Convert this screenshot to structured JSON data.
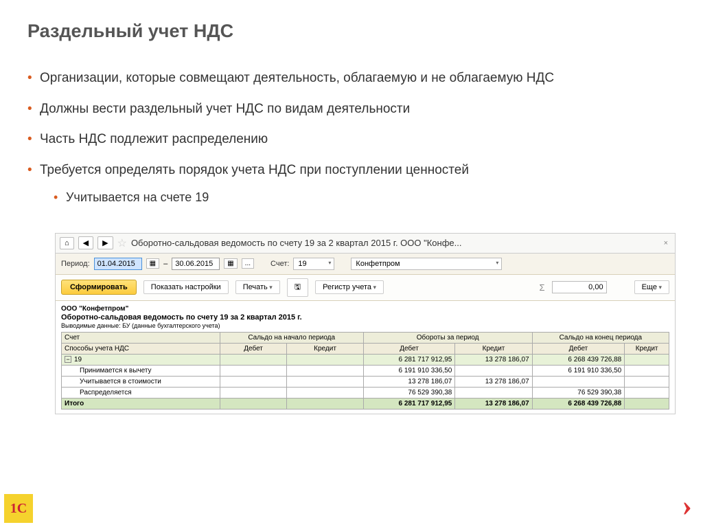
{
  "title": "Раздельный учет НДС",
  "bullets": [
    "Организации, которые совмещают деятельность, облагаемую и не облагаемую НДС",
    "Должны вести раздельный учет НДС по видам деятельности",
    "Часть НДС подлежит распределению",
    "Требуется определять порядок учета НДС при поступлении ценностей"
  ],
  "sub_bullet": "Учитывается на счете 19",
  "app": {
    "doc_title": "Оборотно-сальдовая ведомость по счету 19 за 2 квартал 2015 г. ООО \"Конфе...",
    "home": "⌂",
    "filter": {
      "period_label": "Период:",
      "date_from": "01.04.2015",
      "date_to": "30.06.2015",
      "dots": "...",
      "acct_label": "Счет:",
      "acct_val": "19",
      "org_val": "Конфетпром"
    },
    "toolbar": {
      "form": "Сформировать",
      "show_settings": "Показать настройки",
      "print": "Печать",
      "register": "Регистр учета",
      "numval": "0,00",
      "more": "Еще"
    },
    "report": {
      "org": "ООО \"Конфетпром\"",
      "title": "Оборотно-сальдовая ведомость по счету 19 за 2 квартал 2015 г.",
      "note": "Выводимые данные: БУ (данные бухгалтерского учета)",
      "head": {
        "c1a": "Счет",
        "c1b": "Способы учета НДС",
        "g1": "Сальдо на начало периода",
        "g2": "Обороты за период",
        "g3": "Сальдо на конец периода",
        "d": "Дебет",
        "k": "Кредит"
      },
      "rows": [
        {
          "lvl": "main",
          "name": "19",
          "d1": "",
          "k1": "",
          "d2": "6 281 717 912,95",
          "k2": "13 278 186,07",
          "d3": "6 268 439 726,88",
          "k3": ""
        },
        {
          "lvl": "sub",
          "name": "Принимается к вычету",
          "d1": "",
          "k1": "",
          "d2": "6 191 910 336,50",
          "k2": "",
          "d3": "6 191 910 336,50",
          "k3": ""
        },
        {
          "lvl": "sub",
          "name": "Учитывается в стоимости",
          "d1": "",
          "k1": "",
          "d2": "13 278 186,07",
          "k2": "13 278 186,07",
          "d3": "",
          "k3": ""
        },
        {
          "lvl": "sub",
          "name": "Распределяется",
          "d1": "",
          "k1": "",
          "d2": "76 529 390,38",
          "k2": "",
          "d3": "76 529 390,38",
          "k3": ""
        },
        {
          "lvl": "total",
          "name": "Итого",
          "d1": "",
          "k1": "",
          "d2": "6 281 717 912,95",
          "k2": "13 278 186,07",
          "d3": "6 268 439 726,88",
          "k3": ""
        }
      ]
    }
  }
}
